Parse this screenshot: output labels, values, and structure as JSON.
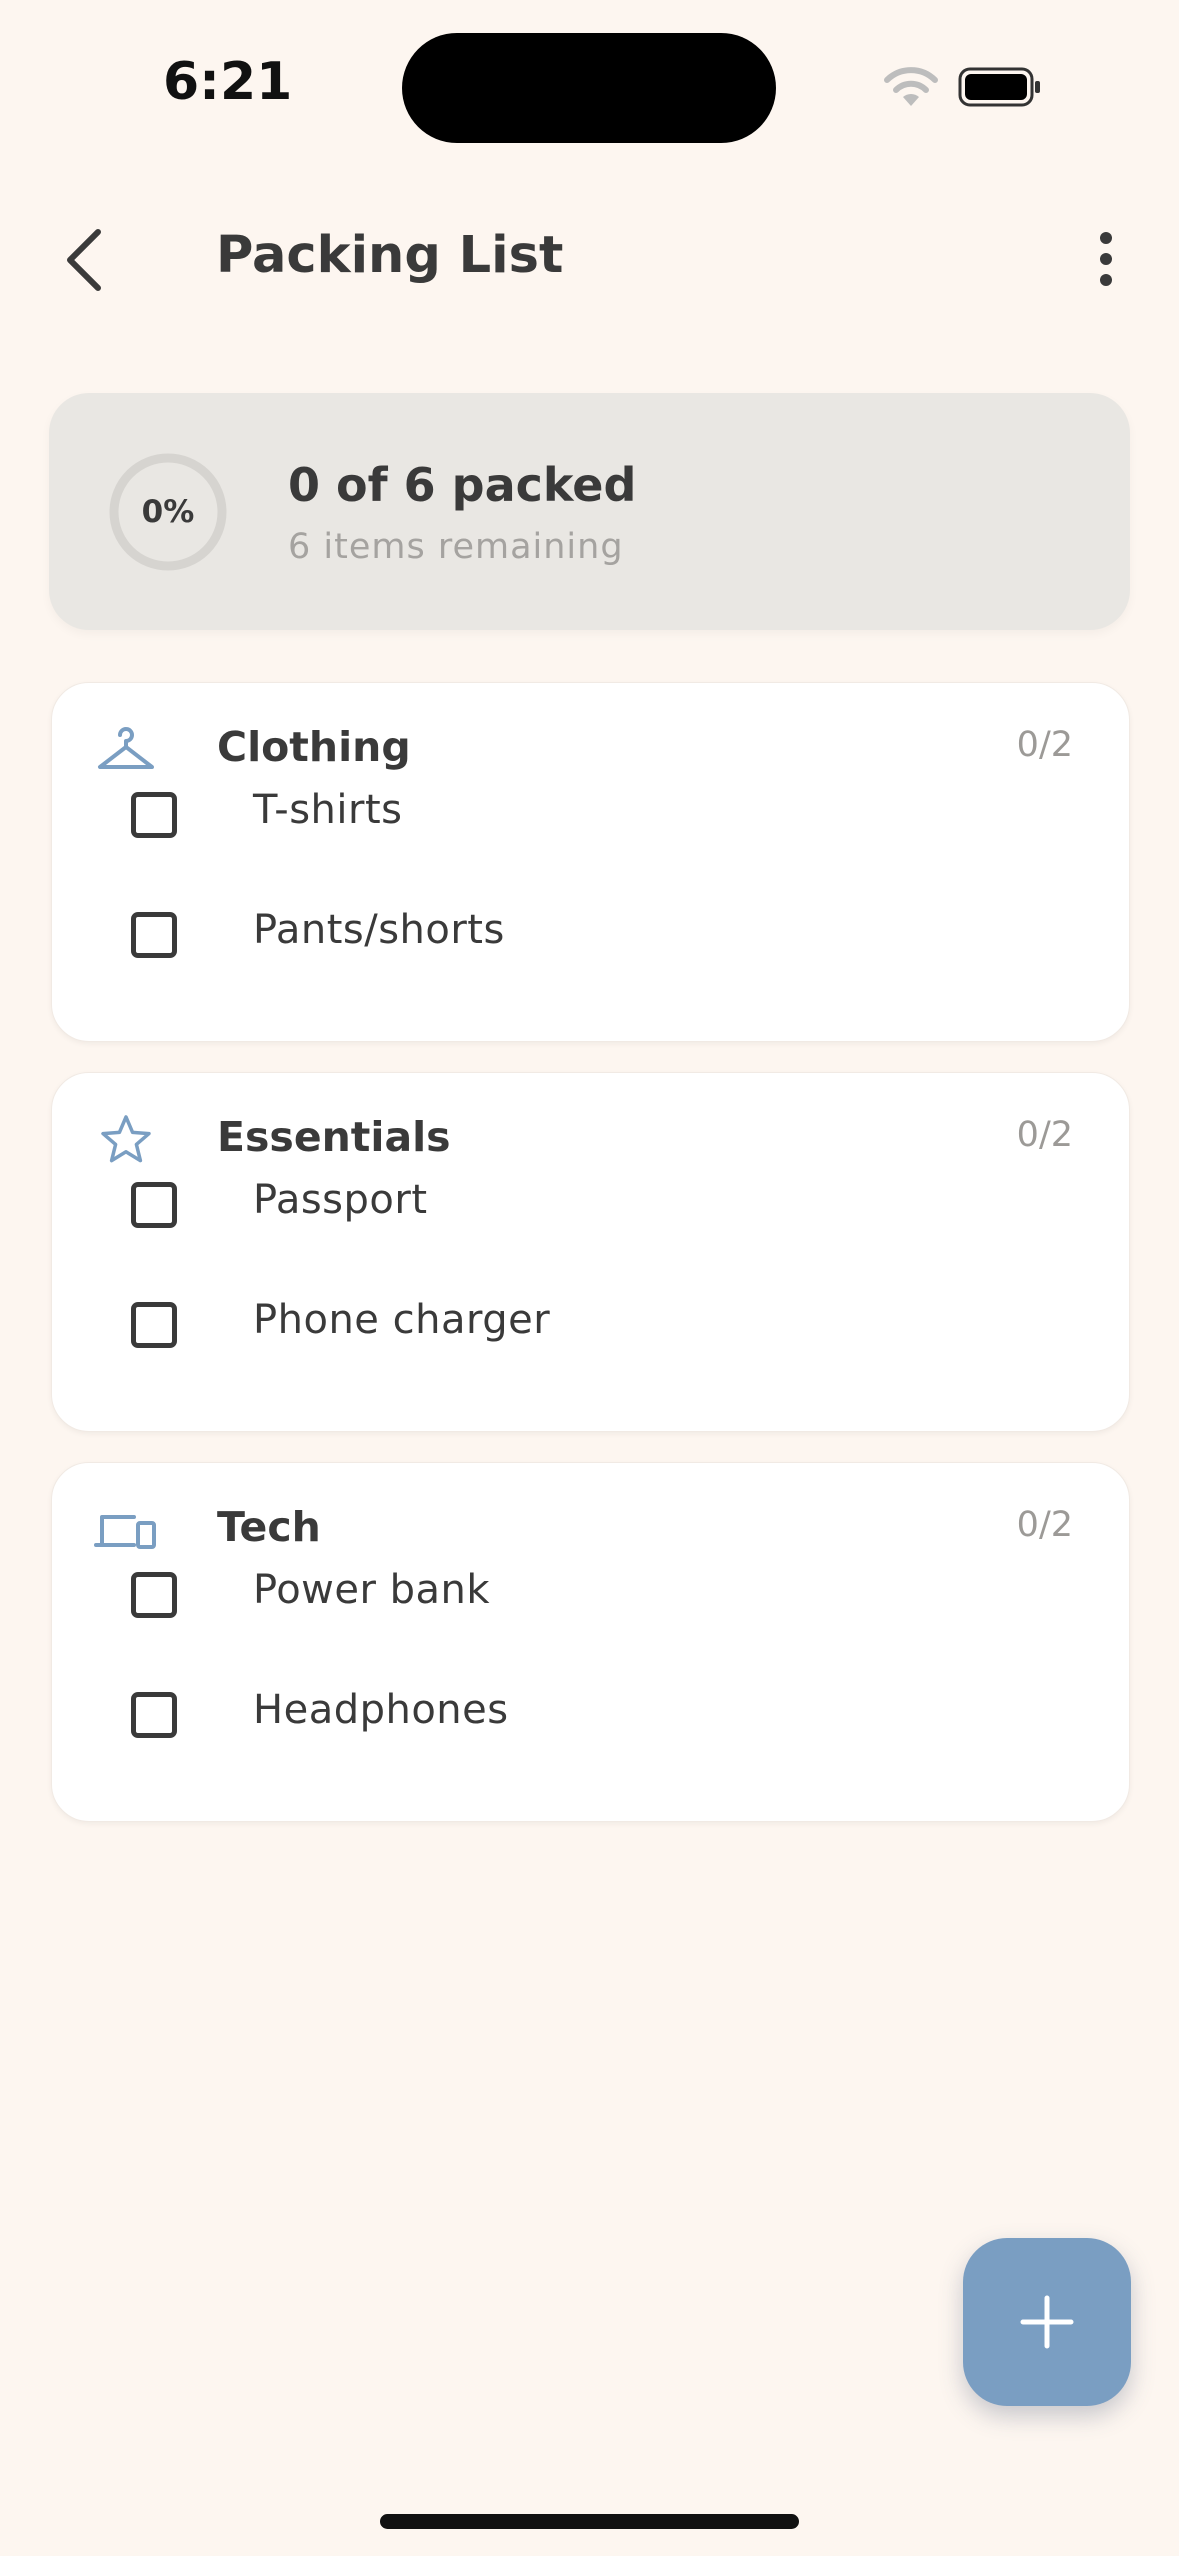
{
  "status_bar": {
    "time": "6:21",
    "wifi_icon": "wifi-icon",
    "battery_icon": "battery-icon"
  },
  "header": {
    "title": "Packing List",
    "back_icon": "chevron-left-icon",
    "menu_icon": "more-vertical-icon"
  },
  "progress": {
    "percent_label": "0%",
    "percent_value": 0,
    "main_text": "0 of 6 packed",
    "sub_text": "6 items remaining"
  },
  "categories": [
    {
      "title": "Clothing",
      "icon": "hanger-icon",
      "count": "0/2",
      "items": [
        {
          "label": "T-shirts",
          "checked": false
        },
        {
          "label": "Pants/shorts",
          "checked": false
        }
      ]
    },
    {
      "title": "Essentials",
      "icon": "star-icon",
      "count": "0/2",
      "items": [
        {
          "label": "Passport",
          "checked": false
        },
        {
          "label": "Phone charger",
          "checked": false
        }
      ]
    },
    {
      "title": "Tech",
      "icon": "devices-icon",
      "count": "0/2",
      "items": [
        {
          "label": "Power bank",
          "checked": false
        },
        {
          "label": "Headphones",
          "checked": false
        }
      ]
    }
  ],
  "fab": {
    "icon": "plus-icon"
  },
  "colors": {
    "background": "#FDF6F0",
    "accent": "#7A9EC2",
    "text": "#3A3A3A",
    "muted": "#A5A3A0",
    "card": "#FFFFFF",
    "progress_card": "#E9E7E3"
  }
}
